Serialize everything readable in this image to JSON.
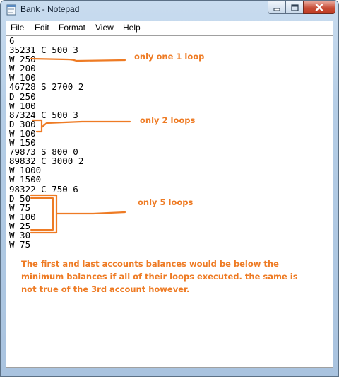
{
  "window": {
    "title": "Bank - Notepad"
  },
  "menu": [
    "File",
    "Edit",
    "Format",
    "View",
    "Help"
  ],
  "document_text": "6\n35231 C 500 3\nW 250\nW 200\nW 100\n46728 S 2700 2\nD 250\nW 100\n87324 C 500 3\nD 300\nW 100\nW 150\n79873 S 800 0\n89832 C 3000 2\nW 1000\nW 1500\n98322 C 750 6\nD 50\nW 75\nW 100\nW 25\nW 30\nW 75",
  "annotations": {
    "loop1": "only one 1 loop",
    "loop2": "only 2 loops",
    "loop5": "only 5 loops",
    "note": "The first and last accounts balances would be below the minimum balances if all of their loops executed. the same is not true of the 3rd account however."
  },
  "colors": {
    "annotation": "#ee7b24"
  }
}
